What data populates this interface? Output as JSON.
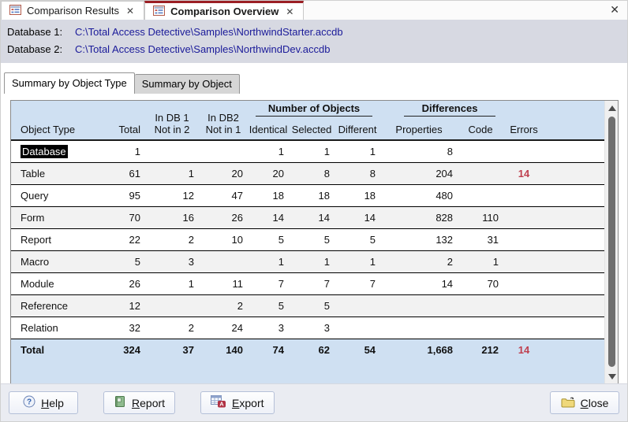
{
  "tab_bar": {
    "tabs": [
      {
        "label": "Comparison Results",
        "close": "✕"
      },
      {
        "label": "Comparison Overview",
        "close": "✕"
      }
    ],
    "window_close": "✕"
  },
  "db_info": {
    "db1": {
      "label": "Database 1:",
      "path": "C:\\Total Access Detective\\Samples\\NorthwindStarter.accdb"
    },
    "db2": {
      "label": "Database 2:",
      "path": "C:\\Total Access Detective\\Samples\\NorthwindDev.accdb"
    }
  },
  "view_tabs": [
    {
      "label": "Summary by Object Type",
      "active": true
    },
    {
      "label": "Summary by Object",
      "active": false
    }
  ],
  "table": {
    "group_headers": {
      "number_of_objects": "Number of Objects",
      "differences": "Differences"
    },
    "columns": {
      "object_type": "Object Type",
      "total": "Total",
      "in_db1_line1": "In DB 1",
      "in_db1_line2": "Not in 2",
      "in_db2_line1": "In DB2",
      "in_db2_line2": "Not in 1",
      "identical": "Identical",
      "selected": "Selected",
      "different": "Different",
      "properties": "Properties",
      "code": "Code",
      "errors": "Errors"
    },
    "rows": [
      {
        "cells": [
          "Database",
          "1",
          "",
          "",
          "1",
          "1",
          "1",
          "8",
          "",
          ""
        ],
        "highlight_first": true
      },
      {
        "cells": [
          "Table",
          "61",
          "1",
          "20",
          "20",
          "8",
          "8",
          "204",
          "",
          "14"
        ]
      },
      {
        "cells": [
          "Query",
          "95",
          "12",
          "47",
          "18",
          "18",
          "18",
          "480",
          "",
          ""
        ]
      },
      {
        "cells": [
          "Form",
          "70",
          "16",
          "26",
          "14",
          "14",
          "14",
          "828",
          "110",
          ""
        ]
      },
      {
        "cells": [
          "Report",
          "22",
          "2",
          "10",
          "5",
          "5",
          "5",
          "132",
          "31",
          ""
        ]
      },
      {
        "cells": [
          "Macro",
          "5",
          "3",
          "",
          "1",
          "1",
          "1",
          "2",
          "1",
          ""
        ]
      },
      {
        "cells": [
          "Module",
          "26",
          "1",
          "11",
          "7",
          "7",
          "7",
          "14",
          "70",
          ""
        ]
      },
      {
        "cells": [
          "Reference",
          "12",
          "",
          "2",
          "5",
          "5",
          "",
          "",
          "",
          ""
        ]
      },
      {
        "cells": [
          "Relation",
          "32",
          "2",
          "24",
          "3",
          "3",
          "",
          "",
          "",
          ""
        ]
      }
    ],
    "total_row": {
      "cells": [
        "Total",
        "324",
        "37",
        "140",
        "74",
        "62",
        "54",
        "1,668",
        "212",
        "14"
      ]
    }
  },
  "buttons": {
    "help": {
      "label": "Help"
    },
    "report": {
      "label": "Report"
    },
    "export": {
      "label": "Export"
    },
    "close": {
      "label": "Close"
    }
  },
  "colors": {
    "accent_red": "#bf404f",
    "header_blue": "#cfe0f2",
    "path_navy": "#1a1a99",
    "active_tab_red": "#9b1f24",
    "db_band": "#d7d9e2"
  }
}
